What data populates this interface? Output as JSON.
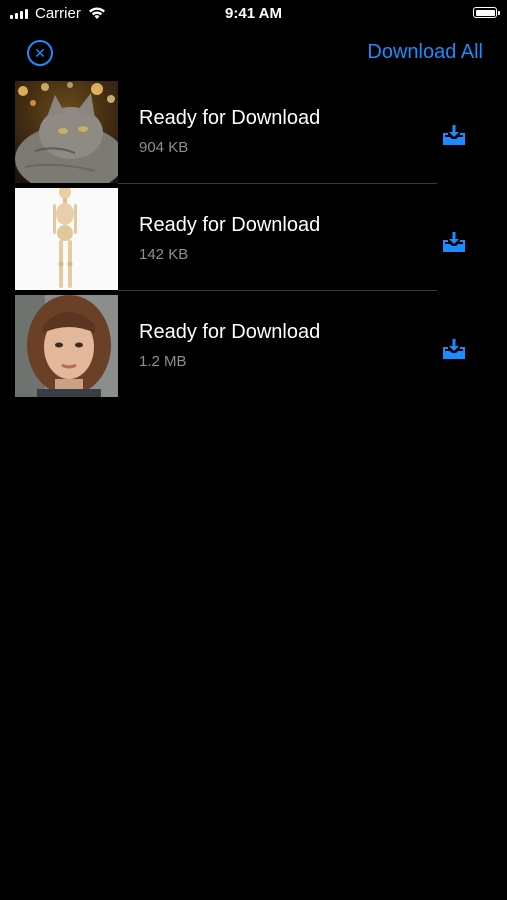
{
  "status_bar": {
    "carrier": "Carrier",
    "time": "9:41 AM"
  },
  "nav": {
    "close_icon": "close-icon",
    "download_all_label": "Download All"
  },
  "items": [
    {
      "title": "Ready for Download",
      "size": "904 KB",
      "thumbnail": "cat-photo"
    },
    {
      "title": "Ready for Download",
      "size": "142 KB",
      "thumbnail": "wooden-mannequin"
    },
    {
      "title": "Ready for Download",
      "size": "1.2 MB",
      "thumbnail": "woman-portrait"
    }
  ],
  "colors": {
    "accent": "#1a8cff",
    "background": "#000000",
    "secondary_text": "#8e8e93"
  }
}
